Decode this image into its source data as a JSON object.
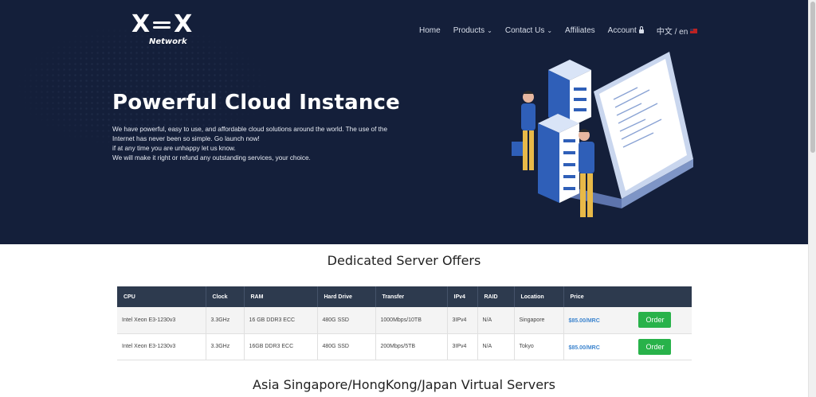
{
  "brand": {
    "logo_letters": [
      "X",
      "X"
    ],
    "logo_sub": "Network"
  },
  "nav": {
    "items": [
      {
        "label": "Home",
        "dropdown": false
      },
      {
        "label": "Products",
        "dropdown": true
      },
      {
        "label": "Contact Us",
        "dropdown": true
      },
      {
        "label": "Affiliates",
        "dropdown": false
      },
      {
        "label": "Account",
        "icon": "lock-icon"
      },
      {
        "label": "中文 / en",
        "icon": "flag-icon"
      }
    ]
  },
  "hero": {
    "title": "Powerful Cloud Instance",
    "lines": [
      "We have powerful, easy to use, and affordable cloud solutions around the world. The use of the",
      "Internet has never been so simple. Go launch now!",
      "if at any time you are unhappy let us know.",
      "We will make it right or refund any outstanding services, your choice."
    ]
  },
  "dedicated": {
    "title": "Dedicated Server Offers",
    "columns": [
      "CPU",
      "Clock",
      "RAM",
      "Hard Drive",
      "Transfer",
      "IPv4",
      "RAID",
      "Location",
      "Price"
    ],
    "rows": [
      {
        "cpu": "Intel Xeon E3-1230v3",
        "clock": "3.3GHz",
        "ram": "16 GB DDR3 ECC",
        "disk": "480G SSD",
        "transfer": "1000Mbps/10TB",
        "ipv4": "3IPv4",
        "raid": "N/A",
        "location": "Singapore",
        "price": "$85.00/MRC",
        "button": "Order"
      },
      {
        "cpu": "Intel Xeon E3-1230v3",
        "clock": "3.3GHz",
        "ram": "16GB DDR3 ECC",
        "disk": "480G SSD",
        "transfer": "200Mbps/5TB",
        "ipv4": "3IPv4",
        "raid": "N/A",
        "location": "Tokyo",
        "price": "$85.00/MRC",
        "button": "Order"
      }
    ]
  },
  "virtual": {
    "title": "Asia Singapore/HongKong/Japan Virtual Servers"
  },
  "colors": {
    "hero_bg": "#141f3a",
    "table_header": "#2d3a4e",
    "order_green": "#28b24a",
    "price_blue": "#3f86cf"
  }
}
